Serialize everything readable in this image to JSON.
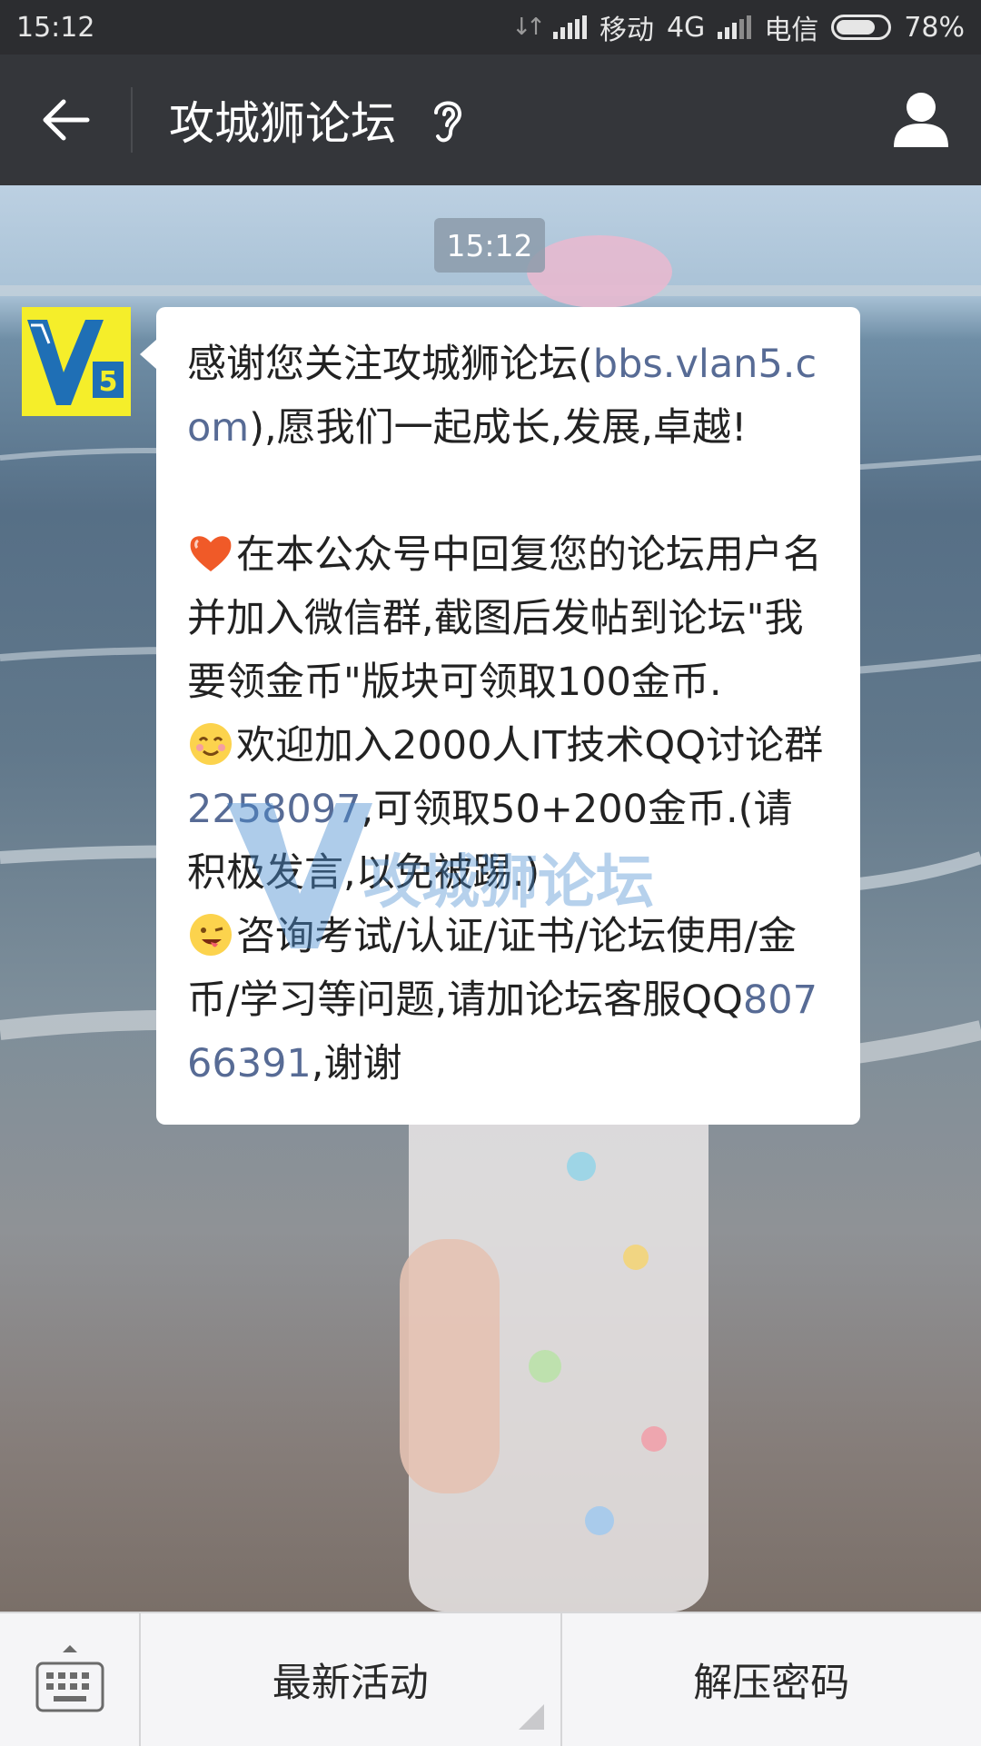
{
  "status_bar": {
    "time": "15:12",
    "carrier1": "移动",
    "network": "4G",
    "carrier2": "电信",
    "battery": "78%",
    "battery_level": 0.78
  },
  "nav": {
    "title": "攻城狮论坛",
    "back_icon": "arrow-left-icon",
    "mode_icon": "ear-icon",
    "profile_icon": "person-icon"
  },
  "chat": {
    "timestamp": "15:12",
    "avatar_text": "V5",
    "message": {
      "p1_a": "感谢您关注攻城狮论坛(",
      "p1_link": "bbs.vlan5.com",
      "p1_b": "),愿我们一起成长,发展,卓越!",
      "p2": "在本公众号中回复您的论坛用户名并加入微信群,截图后发帖到论坛\"我要领金币\"版块可领取100金币.",
      "p3_a": "欢迎加入2000人IT技术QQ讨论群",
      "p3_link": "2258097",
      "p3_b": ",可领取50+200金币.(请积极发言,以免被踢.)",
      "p4_a": "咨询考试/认证/证书/论坛使用/金币/学习等问题,请加论坛客服QQ",
      "p4_link": "80766391",
      "p4_b": ",谢谢"
    },
    "watermark_brand": "攻城狮论坛",
    "watermark_logo": "V5"
  },
  "bottom_menu": {
    "keyboard_icon": "keyboard-icon",
    "items": [
      "最新活动",
      "解压密码"
    ]
  },
  "colors": {
    "link": "#576b95",
    "nav_bg": "#34363a",
    "avatar_bg": "#f5ee2a"
  }
}
